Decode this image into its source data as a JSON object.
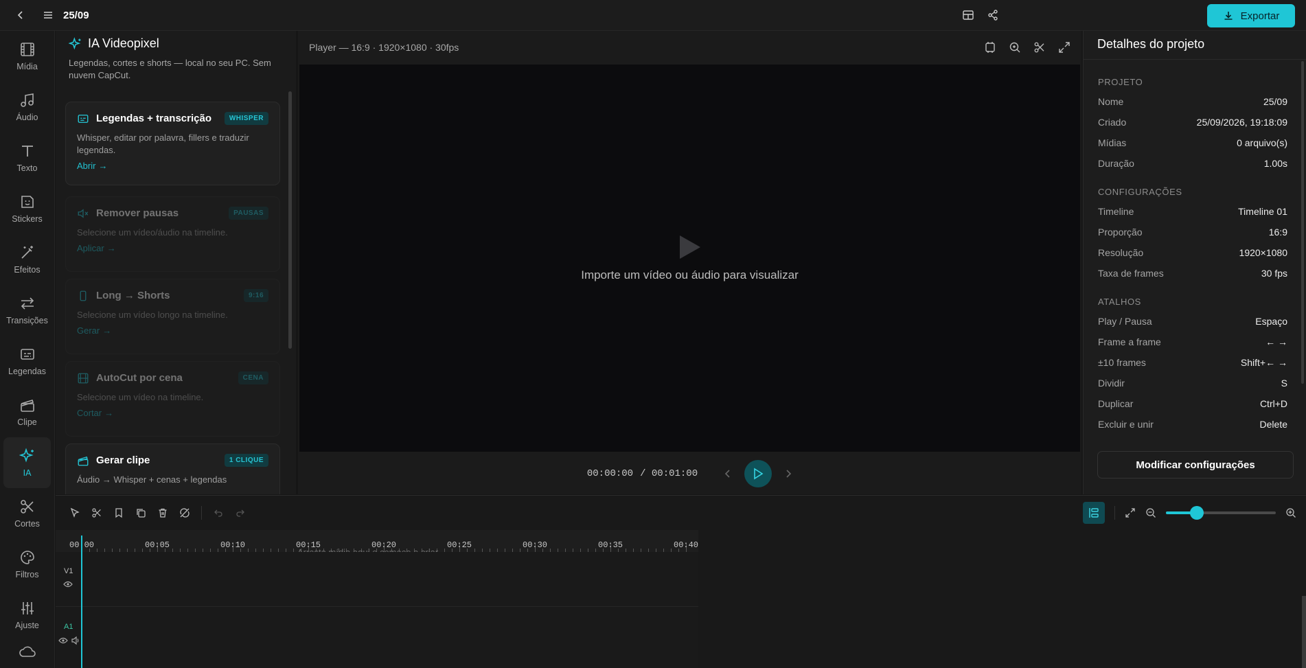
{
  "topbar": {
    "title": "25/09",
    "export_label": "Exportar"
  },
  "rail": [
    {
      "label": "Mídia",
      "icon": "film-icon"
    },
    {
      "label": "Áudio",
      "icon": "music-icon"
    },
    {
      "label": "Texto",
      "icon": "text-icon"
    },
    {
      "label": "Stickers",
      "icon": "sticker-icon"
    },
    {
      "label": "Efeitos",
      "icon": "wand-icon"
    },
    {
      "label": "Transições",
      "icon": "arrows-icon"
    },
    {
      "label": "Legendas",
      "icon": "captions-icon"
    },
    {
      "label": "Clipe",
      "icon": "clapper-icon"
    },
    {
      "label": "IA",
      "icon": "sparkle-icon"
    },
    {
      "label": "Cortes",
      "icon": "scissors-icon"
    },
    {
      "label": "Filtros",
      "icon": "palette-icon"
    },
    {
      "label": "Ajuste",
      "icon": "sliders-icon"
    }
  ],
  "ai_panel": {
    "title": "IA Videopixel",
    "subtitle": "Legendas, cortes e shorts — local no seu PC. Sem nuvem CapCut.",
    "cards": [
      {
        "title": "Legendas + transcrição",
        "tag": "WHISPER",
        "desc": "Whisper, editar por palavra, fillers e traduzir legendas.",
        "action": "Abrir"
      },
      {
        "title": "Remover pausas",
        "tag": "PAUSAS",
        "desc": "Selecione um vídeo/áudio na timeline.",
        "action": "Aplicar"
      },
      {
        "title": "Long → Shorts",
        "tag": "9:16",
        "desc": "Selecione um vídeo longo na timeline.",
        "action": "Gerar"
      },
      {
        "title": "AutoCut por cena",
        "tag": "CENA",
        "desc": "Selecione um vídeo na timeline.",
        "action": "Cortar"
      },
      {
        "title": "Gerar clipe",
        "tag": "1 CLIQUE",
        "desc": "Áudio → Whisper + cenas + legendas",
        "action": ""
      }
    ]
  },
  "player": {
    "info": "Player — 16:9 · 1920×1080 · 30fps",
    "empty_message": "Importe um vídeo ou áudio para visualizar",
    "current_time": "00:00:00",
    "total_time": "/ 00:01:00"
  },
  "details": {
    "title": "Detalhes do projeto",
    "sections": [
      {
        "heading": "PROJETO",
        "rows": [
          [
            "Nome",
            "25/09"
          ],
          [
            "Criado",
            "25/09/2026, 19:18:09"
          ],
          [
            "Mídias",
            "0 arquivo(s)"
          ],
          [
            "Duração",
            "1.00s"
          ]
        ]
      },
      {
        "heading": "CONFIGURAÇÕES",
        "rows": [
          [
            "Timeline",
            "Timeline 01"
          ],
          [
            "Proporção",
            "16:9"
          ],
          [
            "Resolução",
            "1920×1080"
          ],
          [
            "Taxa de frames",
            "30 fps"
          ]
        ]
      },
      {
        "heading": "ATALHOS",
        "rows": [
          [
            "Play / Pausa",
            "Espaço"
          ],
          [
            "Frame a frame",
            "← →"
          ],
          [
            "±10 frames",
            "Shift+← →"
          ],
          [
            "Dividir",
            "S"
          ],
          [
            "Duplicar",
            "Ctrl+D"
          ],
          [
            "Excluir e unir",
            "Delete"
          ]
        ]
      }
    ],
    "button": "Modificar configurações"
  },
  "timeline": {
    "ticks": [
      "00:00",
      "00:05",
      "00:10",
      "00:15",
      "00:20",
      "00:25",
      "00:30",
      "00:35",
      "00:40"
    ],
    "hint": "Arraste mídia aqui e comece a criar",
    "tracks": [
      {
        "label": "V1"
      },
      {
        "label": "A1"
      }
    ],
    "zoom_level": 0.28
  },
  "colors": {
    "accent": "#1fc6d6"
  }
}
